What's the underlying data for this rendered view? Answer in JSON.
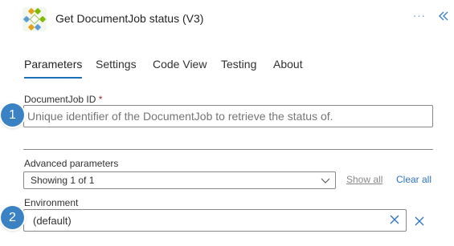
{
  "header": {
    "title": "Get DocumentJob status (V3)",
    "more_label": "···",
    "collapse_icon": "double-chevron-left-icon",
    "app_icon": "connector-icon",
    "accent_color": "#1f6fb8"
  },
  "tabs": [
    {
      "label": "Parameters",
      "active": true
    },
    {
      "label": "Settings",
      "active": false
    },
    {
      "label": "Code View",
      "active": false
    },
    {
      "label": "Testing",
      "active": false
    },
    {
      "label": "About",
      "active": false
    }
  ],
  "document_job_id": {
    "label": "DocumentJob ID",
    "required_mark": "*",
    "placeholder": "Unique identifier of the DocumentJob to retrieve the status of.",
    "value": ""
  },
  "advanced": {
    "label": "Advanced parameters",
    "selected": "Showing 1 of 1",
    "show_all": "Show all",
    "clear_all": "Clear all"
  },
  "environment": {
    "label": "Environment",
    "value": "(default)"
  },
  "step_markers": {
    "first": "1",
    "second": "2",
    "color": "#3b82c4"
  }
}
